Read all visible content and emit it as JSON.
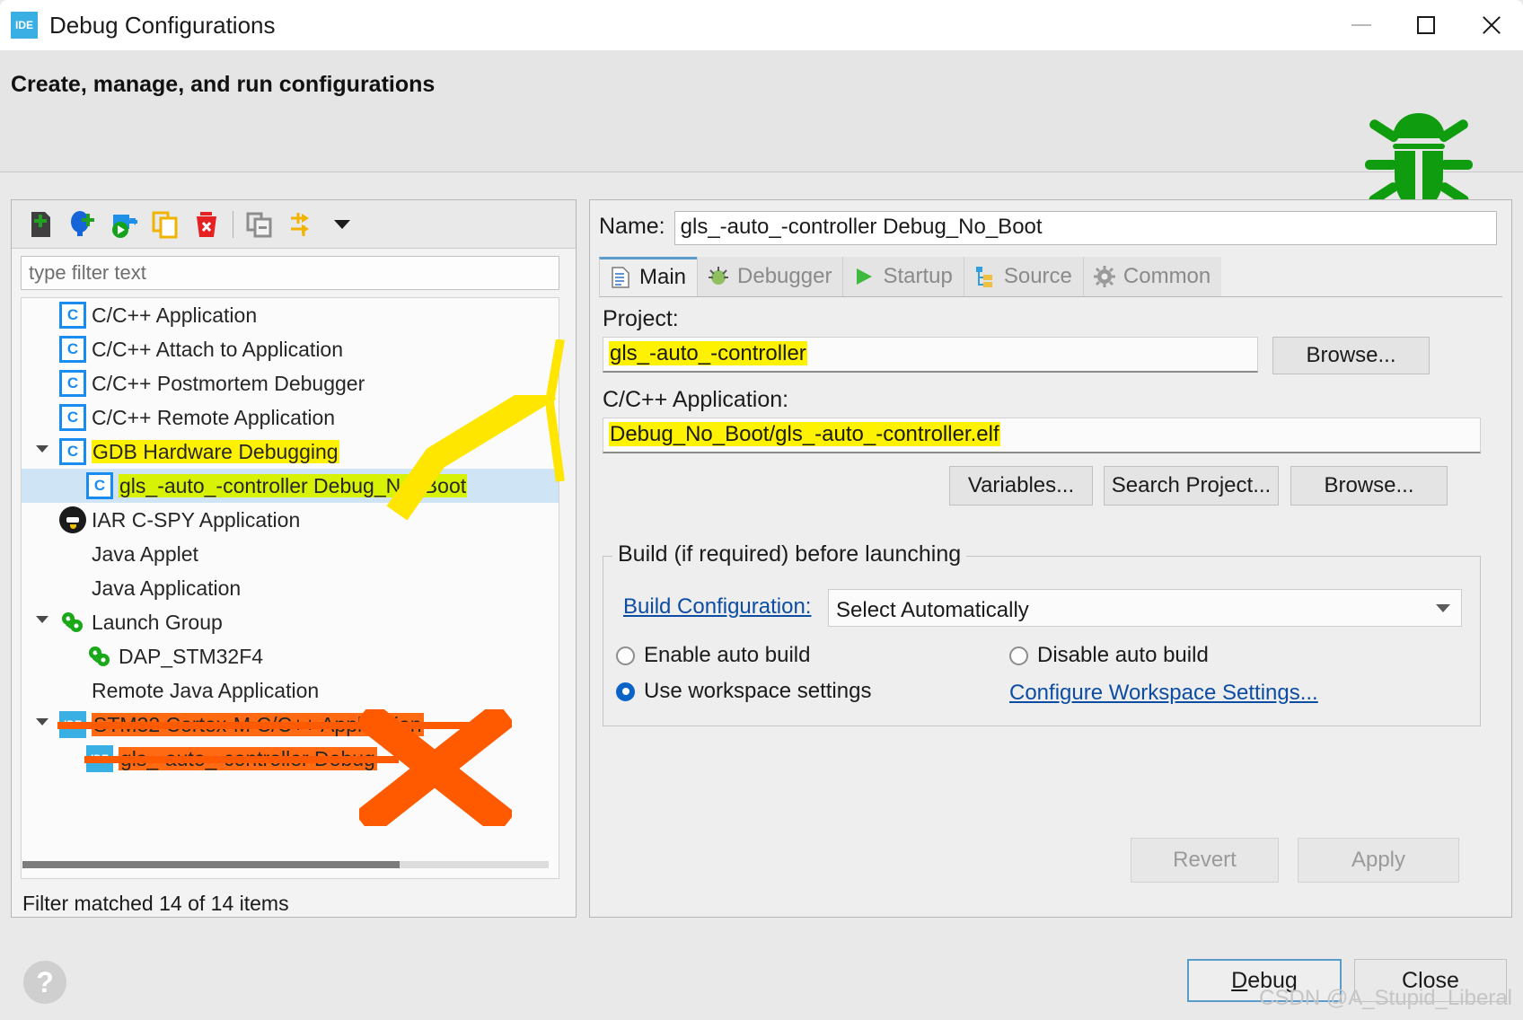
{
  "window": {
    "title": "Debug Configurations",
    "app_icon": "ide-icon",
    "minimize": "minimize-icon",
    "maximize": "maximize-icon",
    "close": "close-icon"
  },
  "header": {
    "title": "Create, manage, and run configurations",
    "decor_icon": "green-bug-icon"
  },
  "toolbar": {
    "buttons": [
      {
        "name": "new-launch-configuration",
        "icon": "new-document-plus-icon"
      },
      {
        "name": "new-prototype",
        "icon": "balloon-plus-icon"
      },
      {
        "name": "export-configuration",
        "icon": "export-arrow-icon"
      },
      {
        "name": "duplicate-configuration",
        "icon": "copy-icon"
      },
      {
        "name": "delete-configuration",
        "icon": "red-trash-icon"
      },
      {
        "name": "collapse-all",
        "icon": "collapse-all-icon"
      },
      {
        "name": "filter-configurations",
        "icon": "filter-arrows-icon"
      },
      {
        "name": "toolbar-menu",
        "icon": "chevron-down-icon"
      }
    ]
  },
  "filter": {
    "placeholder": "type filter text",
    "value": "",
    "status": "Filter matched 14 of 14 items"
  },
  "tree": [
    {
      "label": "C/C++ Application",
      "icon": "c-icon",
      "indent": 1,
      "expander": "none",
      "selected": false,
      "highlight": "none"
    },
    {
      "label": "C/C++ Attach to Application",
      "icon": "c-icon",
      "indent": 1,
      "expander": "none",
      "selected": false,
      "highlight": "none"
    },
    {
      "label": "C/C++ Postmortem Debugger",
      "icon": "c-icon",
      "indent": 1,
      "expander": "none",
      "selected": false,
      "highlight": "none"
    },
    {
      "label": "C/C++ Remote Application",
      "icon": "c-icon",
      "indent": 1,
      "expander": "none",
      "selected": false,
      "highlight": "none"
    },
    {
      "label": "GDB Hardware Debugging",
      "icon": "c-icon",
      "indent": 1,
      "expander": "expanded",
      "selected": false,
      "highlight": "yellow"
    },
    {
      "label": "gls_-auto_-controller Debug_No_Boot",
      "icon": "c-icon",
      "indent": 2,
      "expander": "none",
      "selected": true,
      "highlight": "green"
    },
    {
      "label": "IAR C-SPY Application",
      "icon": "cspy-icon",
      "indent": 1,
      "expander": "none",
      "selected": false,
      "highlight": "none"
    },
    {
      "label": "Java Applet",
      "icon": "none",
      "indent": 1,
      "expander": "none",
      "selected": false,
      "highlight": "none"
    },
    {
      "label": "Java Application",
      "icon": "none",
      "indent": 1,
      "expander": "none",
      "selected": false,
      "highlight": "none"
    },
    {
      "label": "Launch Group",
      "icon": "launch-group-icon",
      "indent": 1,
      "expander": "expanded",
      "selected": false,
      "highlight": "none"
    },
    {
      "label": "DAP_STM32F4",
      "icon": "launch-group-icon",
      "indent": 2,
      "expander": "none",
      "selected": false,
      "highlight": "none"
    },
    {
      "label": "Remote Java Application",
      "icon": "none",
      "indent": 1,
      "expander": "none",
      "selected": false,
      "highlight": "none"
    },
    {
      "label": "STM32 Cortex-M C/C++ Application",
      "icon": "ide-icon",
      "indent": 1,
      "expander": "expanded",
      "selected": false,
      "highlight": "orange"
    },
    {
      "label": "gls_-auto_-controller Debug",
      "icon": "ide-icon",
      "indent": 2,
      "expander": "none",
      "selected": false,
      "highlight": "orange"
    }
  ],
  "details": {
    "name_label": "Name:",
    "name_value": "gls_-auto_-controller Debug_No_Boot",
    "tabs": [
      {
        "label": "Main",
        "icon": "document-icon",
        "active": true
      },
      {
        "label": "Debugger",
        "icon": "bug-gear-icon",
        "active": false
      },
      {
        "label": "Startup",
        "icon": "green-play-icon",
        "active": false
      },
      {
        "label": "Source",
        "icon": "source-tree-icon",
        "active": false
      },
      {
        "label": "Common",
        "icon": "gear-icon",
        "active": false
      }
    ],
    "project_label": "Project:",
    "project_value": "gls_-auto_-controller",
    "project_browse": "Browse...",
    "application_label": "C/C++ Application:",
    "application_value": "Debug_No_Boot/gls_-auto_-controller.elf",
    "variables_button": "Variables...",
    "search_project_button": "Search Project...",
    "app_browse": "Browse...",
    "build_group_title": "Build (if required) before launching",
    "build_config_label": "Build Configuration:",
    "build_config_value": "Select Automatically",
    "enable_auto_build": "Enable auto build",
    "disable_auto_build": "Disable auto build",
    "use_workspace_settings": "Use workspace settings",
    "configure_workspace_link": "Configure Workspace Settings...",
    "selected_build_radio": "use_workspace_settings",
    "revert_button": "Revert",
    "apply_button": "Apply"
  },
  "footer": {
    "help": "?",
    "debug_button": "Debug",
    "close_button": "Close",
    "watermark": "CSDN @A_Stupid_Liberal"
  },
  "colors": {
    "accent_blue": "#3aafe3",
    "highlight_yellow": "#fff200",
    "highlight_green": "#d7f205",
    "mark_orange": "#ff6a13",
    "bug_green": "#0f9d0f",
    "link_blue": "#0c4da2"
  }
}
